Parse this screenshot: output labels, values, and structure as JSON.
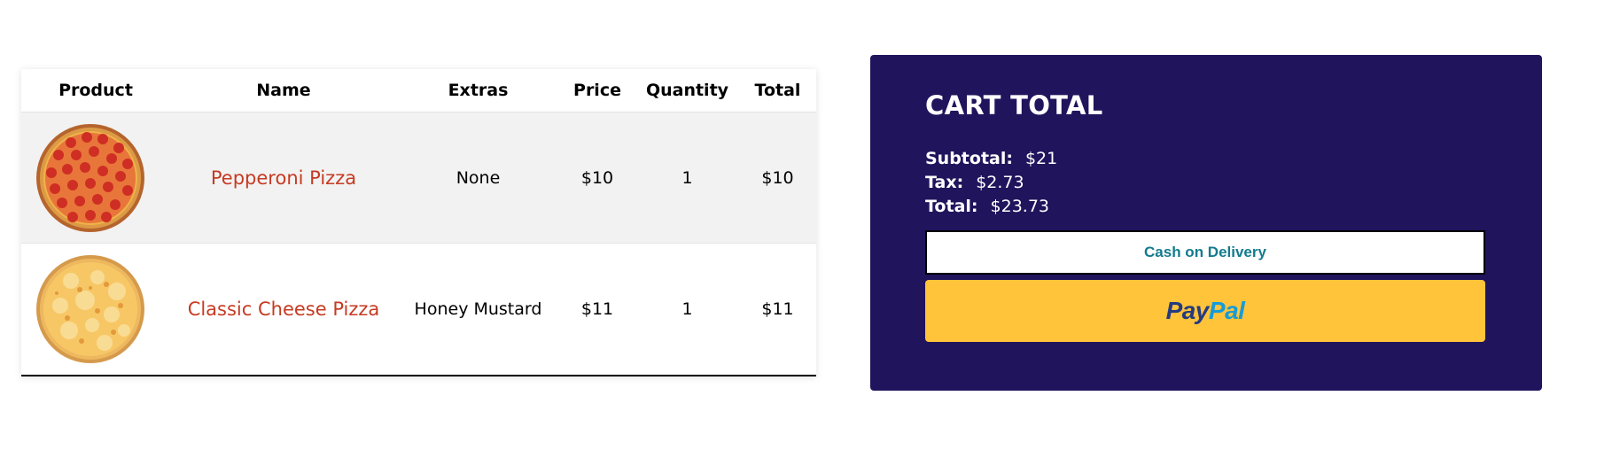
{
  "table": {
    "headers": {
      "product": "Product",
      "name": "Name",
      "extras": "Extras",
      "price": "Price",
      "quantity": "Quantity",
      "total": "Total"
    },
    "rows": [
      {
        "image": "pepperoni-pizza-image",
        "name": "Pepperoni Pizza",
        "extras": "None",
        "price": "$10",
        "quantity": "1",
        "total": "$10"
      },
      {
        "image": "cheese-pizza-image",
        "name": "Classic Cheese Pizza",
        "extras": "Honey Mustard",
        "price": "$11",
        "quantity": "1",
        "total": "$11"
      }
    ]
  },
  "cart_total": {
    "title": "CART TOTAL",
    "subtotal_label": "Subtotal:",
    "subtotal_value": "$21",
    "tax_label": "Tax:",
    "tax_value": "$2.73",
    "total_label": "Total:",
    "total_value": "$23.73",
    "cod_label": "Cash on Delivery",
    "paypal_pay": "Pay",
    "paypal_pal": "Pal"
  },
  "colors": {
    "panel_background": "#20145c",
    "product_name": "#c63a22",
    "cod_text": "#137b8e",
    "paypal_button": "#ffc439",
    "paypal_dark": "#253b80",
    "paypal_light": "#179bd7"
  }
}
